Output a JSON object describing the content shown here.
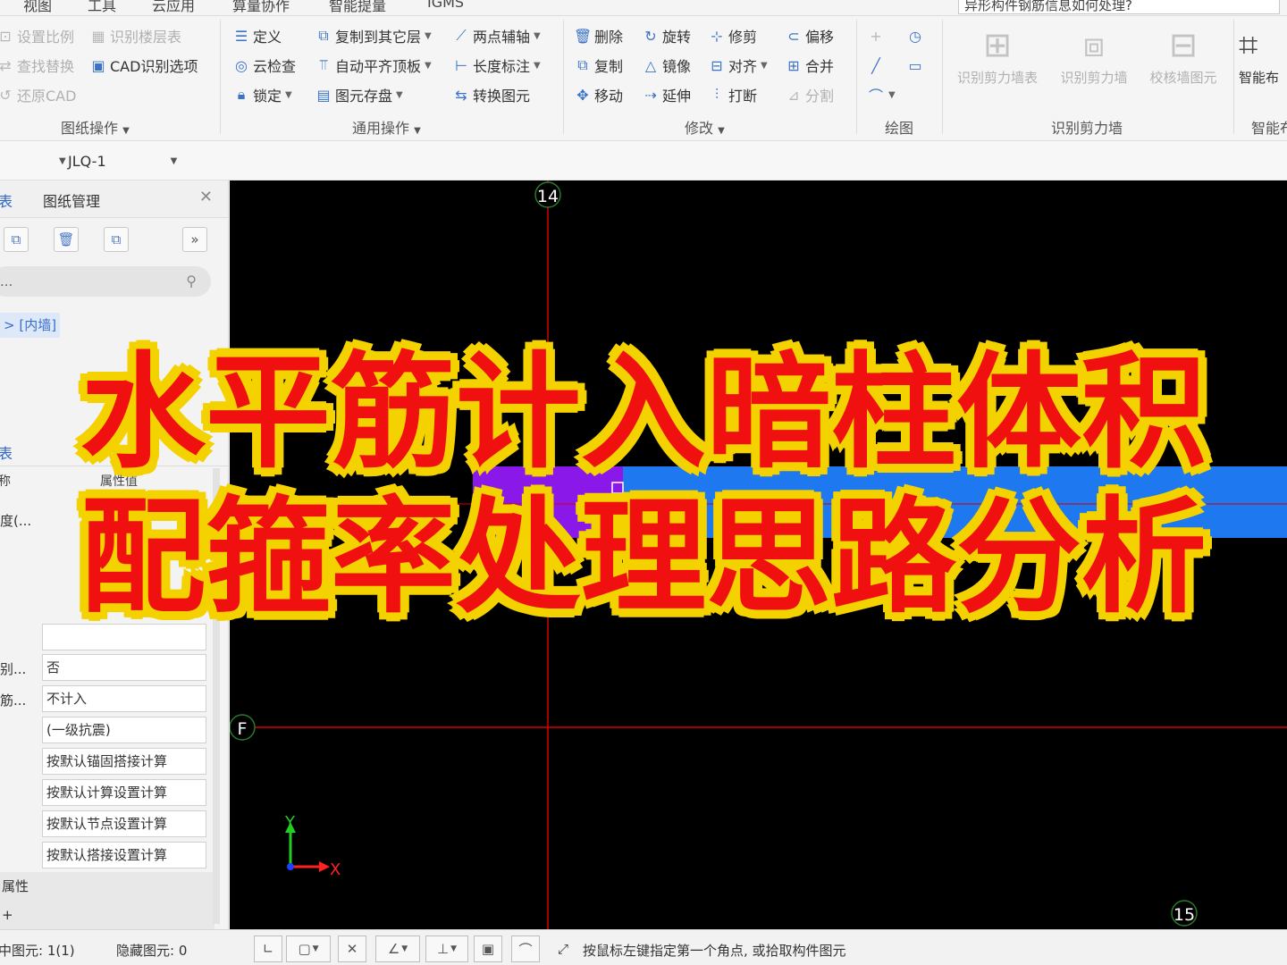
{
  "menu": {
    "items": [
      "视图",
      "工具",
      "云应用",
      "算量协作",
      "智能提量",
      "IGMS"
    ],
    "help_search": "异形构件钢筋信息如何处理?"
  },
  "ribbon": {
    "drawing_ops": {
      "label": "图纸操作",
      "set_scale": "设置比例",
      "identify_floors": "识别楼层表",
      "find_replace": "查找替换",
      "cad_options": "CAD识别选项",
      "restore_cad": "还原CAD"
    },
    "general_ops": {
      "label": "通用操作",
      "define": "定义",
      "copy_to_other_floor": "复制到其它层",
      "two_point_axis": "两点辅轴",
      "cloud_check": "云检查",
      "auto_flush_top": "自动平齐顶板",
      "length_dim": "长度标注",
      "lock": "锁定",
      "element_save": "图元存盘",
      "convert_element": "转换图元"
    },
    "modify": {
      "label": "修改",
      "delete": "删除",
      "rotate": "旋转",
      "trim": "修剪",
      "offset": "偏移",
      "copy": "复制",
      "mirror": "镜像",
      "align": "对齐",
      "merge": "合并",
      "move": "移动",
      "extend": "延伸",
      "break": "打断",
      "split": "分割"
    },
    "draw": {
      "label": "绘图"
    },
    "identify_shear_wall": {
      "label": "识别剪力墙",
      "wall_table": "识别剪力墙表",
      "wall": "识别剪力墙",
      "check_wall": "校核墙图元"
    },
    "smart_layout": {
      "label": "智能布",
      "button": "智能布"
    }
  },
  "toolbar": {
    "element_name": "JLQ-1"
  },
  "left_panel": {
    "tab_list": "表",
    "tab_drawings": "图纸管理",
    "search_placeholder": "...",
    "tree_item": "> [内墙]",
    "prop_tab": "表",
    "col_name": "称",
    "col_value": "属性值",
    "row_labels": [
      "度(..."
    ],
    "properties": [
      {
        "name": "",
        "value": ""
      },
      {
        "name": "别...",
        "value": "否"
      },
      {
        "name": "筋...",
        "value": "不计入"
      },
      {
        "name": "",
        "value": "(一级抗震)"
      },
      {
        "name": "",
        "value": "按默认锚固搭接计算"
      },
      {
        "name": "",
        "value": "按默认计算设置计算"
      },
      {
        "name": "",
        "value": "按默认节点设置计算"
      },
      {
        "name": "",
        "value": "按默认搭接设置计算"
      }
    ],
    "section_attr": "属性",
    "section_more": "+"
  },
  "canvas": {
    "axis_14": "14",
    "axis_15": "15",
    "axis_f": "F",
    "ucs_x": "X",
    "ucs_y": "Y",
    "colors": {
      "bg": "#000000",
      "axis": "#d40000",
      "wall": "#1e78f0",
      "column": "#8a18e8"
    }
  },
  "status": {
    "selected": "中图元: 1(1)",
    "hidden": "隐藏图元: 0",
    "hint": "按鼠标左键指定第一个角点, 或拾取构件图元"
  },
  "overlay": {
    "line1": "水平筋计入暗柱体积",
    "line2": "配箍率处理思路分析"
  }
}
